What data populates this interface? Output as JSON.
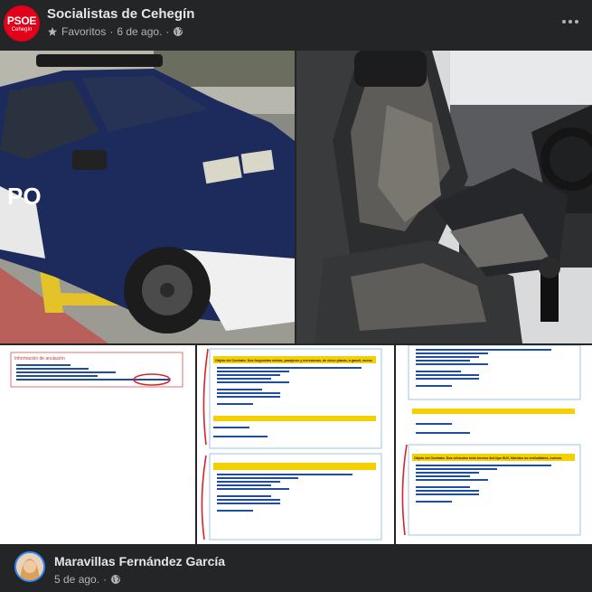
{
  "post": {
    "page_name": "Socialistas de Cehegín",
    "avatar_text": "PSOE",
    "avatar_subtext": "Cehegín",
    "favorites_label": "Favoritos",
    "separator": "·",
    "date": "6 de ago.",
    "privacy_icon": "globe-icon",
    "favorites_icon": "star-icon",
    "more_icon": "more-horizontal-icon"
  },
  "photos": [
    {
      "name": "photo-police-car-exterior",
      "alt": "POLICIA car with worn hood"
    },
    {
      "name": "photo-worn-car-seats",
      "alt": "Worn black car seats interior"
    },
    {
      "name": "photo-doc-adjudication-info",
      "title": "Información de anulación"
    },
    {
      "name": "photo-doc-lot-1",
      "title": "Objeto del Contrato: Dos furgonetas mixtas, pasajeros y mercancías, de cinco plazas, a gasoil, nueva."
    },
    {
      "name": "photo-doc-lot-2",
      "title": "Objeto del Contrato: Dos vehículos todo terreno 4x4 tipo SUV, híbridos no enchufables, nuevos."
    }
  ],
  "comment": {
    "author": "Maravillas Fernández García",
    "date": "5 de ago.",
    "separator": "·",
    "privacy_icon": "globe-icon"
  },
  "colors": {
    "background": "#242526",
    "brand_red": "#e3001b",
    "text_primary": "#e4e6eb",
    "text_secondary": "#b0b3b8",
    "doc_highlight": "#f5d000",
    "doc_link": "#1f4ea1",
    "annotation_red": "#d8232a"
  }
}
